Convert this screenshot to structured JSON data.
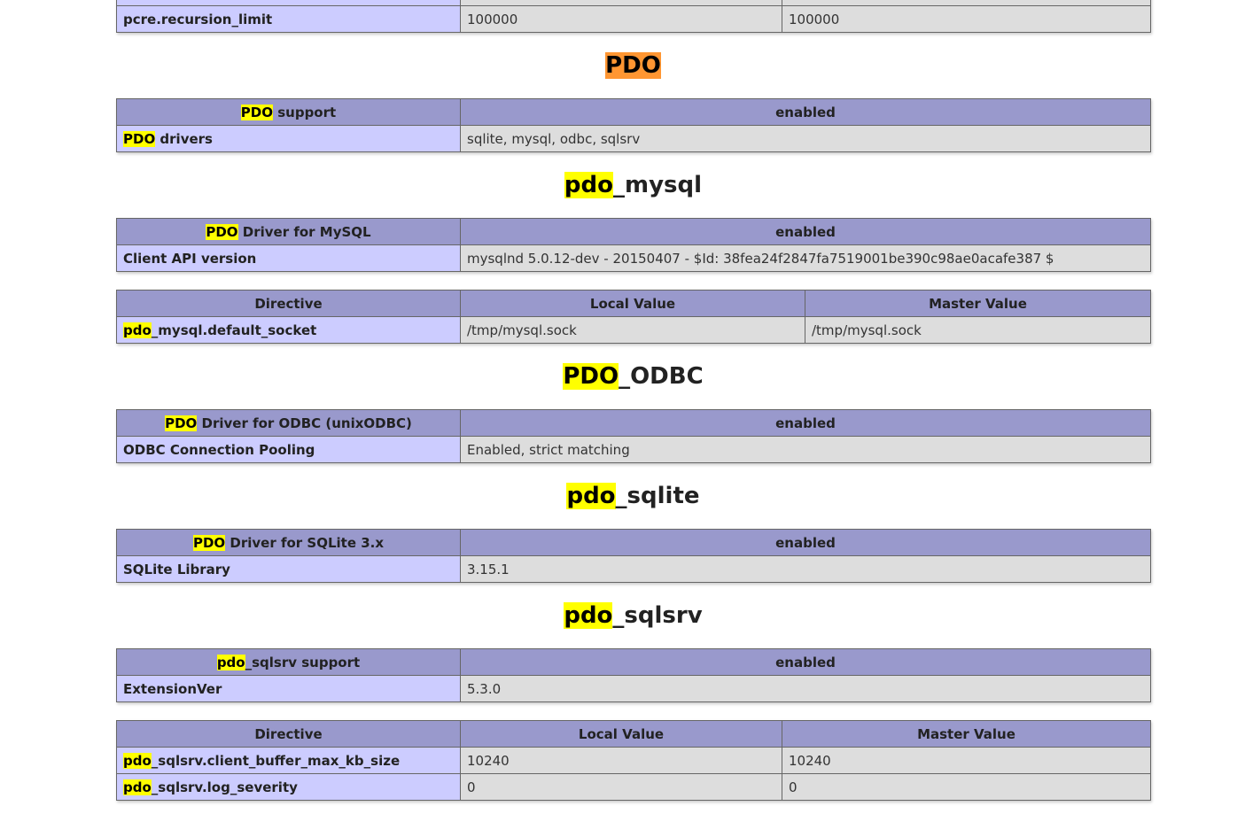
{
  "top_row": {
    "name": "pcre.recursion_limit",
    "local": "100000",
    "master": "100000"
  },
  "sections": {
    "pdo": {
      "title_mark": "PDO",
      "title_rest": "",
      "support_mark": "PDO",
      "support_rest": " support",
      "support_value": "enabled",
      "drivers_mark": "PDO",
      "drivers_rest": " drivers",
      "drivers_value": "sqlite, mysql, odbc, sqlsrv"
    },
    "pdo_mysql": {
      "title_mark": "pdo",
      "title_rest": "_mysql",
      "driver_mark": "PDO",
      "driver_rest": " Driver for MySQL",
      "driver_value": "enabled",
      "api_label": "Client API version",
      "api_value": "mysqlnd 5.0.12-dev - 20150407 - $Id: 38fea24f2847fa7519001be390c98ae0acafe387 $",
      "directive_header": "Directive",
      "local_header": "Local Value",
      "master_header": "Master Value",
      "socket_mark": "pdo",
      "socket_rest": "_mysql.default_socket",
      "socket_local": "/tmp/mysql.sock",
      "socket_master": "/tmp/mysql.sock"
    },
    "pdo_odbc": {
      "title_mark": "PDO",
      "title_rest": "_ODBC",
      "driver_mark": "PDO",
      "driver_rest": " Driver for ODBC (unixODBC)",
      "driver_value": "enabled",
      "pool_label": "ODBC Connection Pooling",
      "pool_value": "Enabled, strict matching"
    },
    "pdo_sqlite": {
      "title_mark": "pdo",
      "title_rest": "_sqlite",
      "driver_mark": "PDO",
      "driver_rest": " Driver for SQLite 3.x",
      "driver_value": "enabled",
      "lib_label": "SQLite Library",
      "lib_value": "3.15.1"
    },
    "pdo_sqlsrv": {
      "title_mark": "pdo",
      "title_rest": "_sqlsrv",
      "support_mark": "pdo",
      "support_rest": "_sqlsrv support",
      "support_value": "enabled",
      "ext_label": "ExtensionVer",
      "ext_value": "5.3.0",
      "directive_header": "Directive",
      "local_header": "Local Value",
      "master_header": "Master Value",
      "rows": [
        {
          "mark": "pdo",
          "rest": "_sqlsrv.client_buffer_max_kb_size",
          "local": "10240",
          "master": "10240"
        },
        {
          "mark": "pdo",
          "rest": "_sqlsrv.log_severity",
          "local": "0",
          "master": "0"
        }
      ]
    }
  },
  "colors": {
    "header_bg": "#9999cc",
    "label_bg": "#ccccff",
    "value_bg": "#dddddd",
    "highlight": "#ffff00",
    "highlight_current": "#ff9632"
  }
}
